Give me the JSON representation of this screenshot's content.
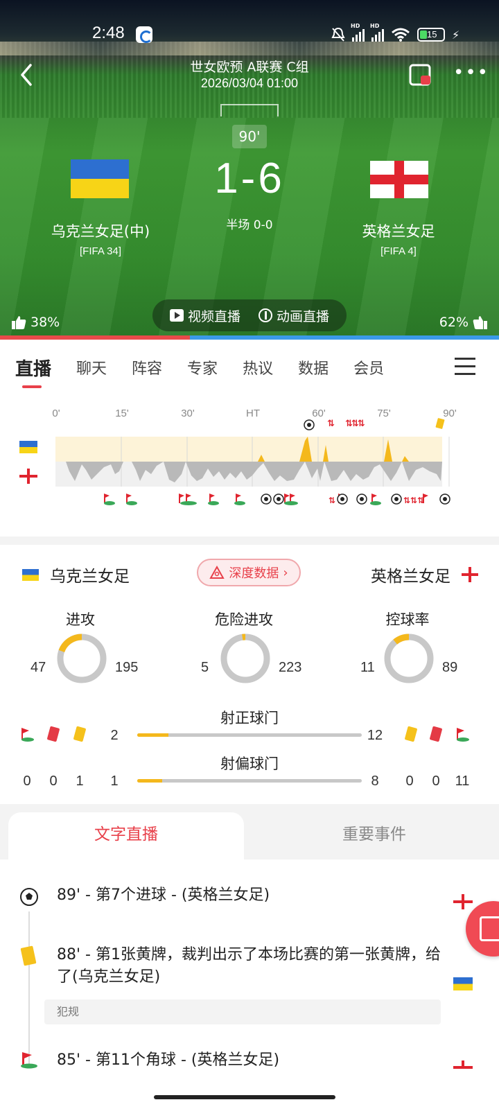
{
  "status_bar": {
    "time": "2:48",
    "battery": "15"
  },
  "header": {
    "title": "世女欧预 A联赛 C组",
    "datetime": "2026/03/04 01:00"
  },
  "match": {
    "minute": "90'",
    "score": "1-6",
    "halftime": "半场 0-0",
    "home": {
      "name": "乌克兰女足(中)",
      "rank": "[FIFA 34]",
      "like": "38%"
    },
    "away": {
      "name": "英格兰女足",
      "rank": "[FIFA 4]",
      "like": "62%"
    },
    "like_home_fraction": 0.38
  },
  "live_options": {
    "video": "视频直播",
    "animation": "动画直播"
  },
  "tabs": [
    "直播",
    "聊天",
    "阵容",
    "专家",
    "热议",
    "数据",
    "会员"
  ],
  "momentum": {
    "ticks": [
      "0'",
      "15'",
      "30'",
      "HT",
      "60'",
      "75'",
      "90'"
    ]
  },
  "stats": {
    "home_name": "乌克兰女足",
    "away_name": "英格兰女足",
    "deep_data_label": "深度数据",
    "rings": [
      {
        "title": "进攻",
        "home": "47",
        "away": "195"
      },
      {
        "title": "危险进攻",
        "home": "5",
        "away": "223"
      },
      {
        "title": "控球率",
        "home": "11",
        "away": "89"
      }
    ],
    "bars": [
      {
        "title": "射正球门",
        "home": "2",
        "away": "12",
        "home_fraction": 0.14
      },
      {
        "title": "射偏球门",
        "home": "1",
        "away": "8",
        "home_fraction": 0.11
      }
    ],
    "home_counts": {
      "corners": "0",
      "red": "0",
      "yellow": "1"
    },
    "away_counts": {
      "yellow": "0",
      "red": "0",
      "corners": "11"
    }
  },
  "sub_tabs": {
    "text_live": "文字直播",
    "key_events": "重要事件"
  },
  "timeline": [
    {
      "icon": "ball-icon",
      "text": "89' - 第7个进球 - (英格兰女足)",
      "side": "away"
    },
    {
      "icon": "yellow-card-icon",
      "text": "88' - 第1张黄牌，裁判出示了本场比赛的第一张黄牌，给了(乌克兰女足)",
      "tag": "犯规",
      "side": "home"
    },
    {
      "icon": "corner-flag-icon",
      "text": "85' - 第11个角球 - (英格兰女足)",
      "side": "away"
    }
  ],
  "colors": {
    "accent": "#e8404a",
    "home_bar": "#e84a4a",
    "away_bar": "#3b9ae8",
    "yellow": "#f4b81c"
  }
}
